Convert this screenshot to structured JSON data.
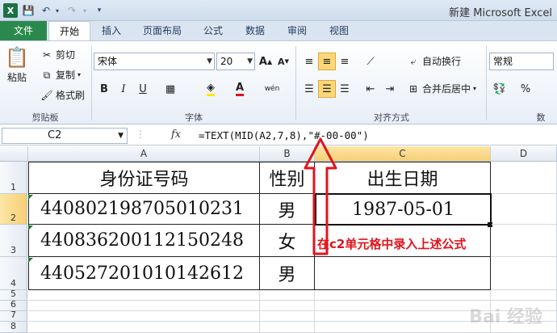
{
  "window": {
    "title": "新建 Microsoft Excel"
  },
  "tabs": [
    {
      "label": "文件"
    },
    {
      "label": "开始"
    },
    {
      "label": "插入"
    },
    {
      "label": "页面布局"
    },
    {
      "label": "公式"
    },
    {
      "label": "数据"
    },
    {
      "label": "审阅"
    },
    {
      "label": "视图"
    }
  ],
  "ribbon": {
    "clipboard": {
      "paste": "粘贴",
      "cut": "剪切",
      "copy": "复制",
      "format_painter": "格式刷",
      "label": "剪贴板"
    },
    "font": {
      "name": "宋体",
      "size": "20",
      "label": "字体",
      "bold": "B",
      "italic": "I",
      "underline": "U",
      "grow": "A",
      "shrink": "A",
      "fontcolor": "A",
      "phonetic": "wén"
    },
    "alignment": {
      "wrap": "自动换行",
      "merge": "合并后居中",
      "label": "对齐方式"
    },
    "number": {
      "format": "常规",
      "percent": "%",
      "label": "数"
    }
  },
  "formula_bar": {
    "name_box": "C2",
    "fx": "fx",
    "formula": "=TEXT(MID(A2,7,8),\"#-00-00\")"
  },
  "sheet": {
    "columns": [
      "A",
      "B",
      "C",
      "D"
    ],
    "rows": [
      "1",
      "2",
      "3",
      "4",
      "5",
      "6",
      "7",
      "8"
    ],
    "cells": {
      "A1": "身份证号码",
      "B1": "性别",
      "C1": "出生日期",
      "A2": "440802198705010231",
      "B2": "男",
      "C2": "1987-05-01",
      "A3": "440836200112150248",
      "B3": "女",
      "A4": "440527201010142612",
      "B4": "男"
    }
  },
  "annotation": "在c2单元格中录入上述公式",
  "watermark": "Bai 经验",
  "colors": {
    "file_tab": "#2a8a4e",
    "annotation": "#e0141c",
    "active_btn": "#fcd77a"
  }
}
